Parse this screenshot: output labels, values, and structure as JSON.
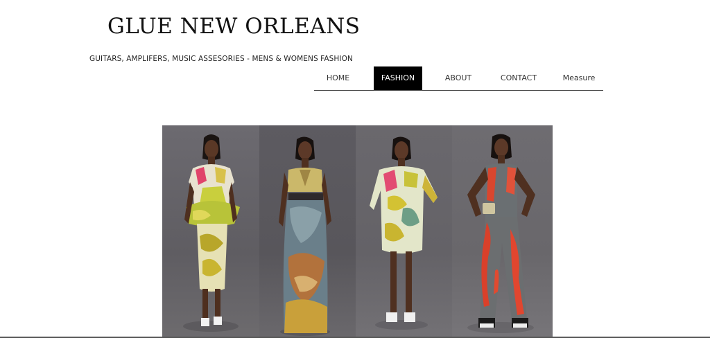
{
  "header": {
    "site_title": "GLUE NEW ORLEANS",
    "tagline": "GUITARS, AMPLIFERS, MUSIC ASSESORIES - MENS & WOMENS FASHION"
  },
  "nav": {
    "items": [
      {
        "label": "HOME",
        "active": false
      },
      {
        "label": "FASHION",
        "active": true
      },
      {
        "label": "ABOUT",
        "active": false
      },
      {
        "label": "CONTACT",
        "active": false
      },
      {
        "label": "Measure",
        "active": false
      }
    ]
  },
  "gallery": {
    "panels": [
      {
        "subject": "model-peplum-dress"
      },
      {
        "subject": "model-gown"
      },
      {
        "subject": "model-shift-dress"
      },
      {
        "subject": "model-jumpsuit"
      }
    ]
  },
  "colors": {
    "background": "#ffffff",
    "nav_active_bg": "#000000",
    "nav_active_text": "#ffffff",
    "text": "#222222"
  }
}
